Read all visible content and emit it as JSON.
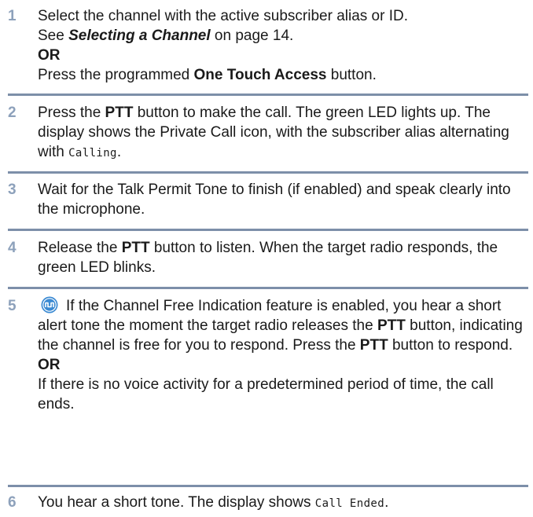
{
  "steps": [
    {
      "num": "1",
      "line1": "Select the channel with the active subscriber alias or ID.",
      "line2_pre": "See ",
      "line2_ref": "Selecting a Channel",
      "line2_post": " on page 14.",
      "or_label": "OR",
      "line4_pre": "Press the programmed ",
      "line4_bold": "One Touch Access",
      "line4_post": " button."
    },
    {
      "num": "2",
      "pre": "Press the ",
      "bold": "PTT",
      "post": " button to make the call. The green LED lights up. The display shows the Private Call icon, with the subscriber alias alternating with ",
      "display_text": "Calling",
      "end": "."
    },
    {
      "num": "3",
      "text": "Wait for the Talk Permit Tone to finish (if enabled) and speak clearly into the microphone."
    },
    {
      "num": "4",
      "pre": "Release the ",
      "bold": "PTT",
      "post": " button to listen. When the target radio responds, the green LED blinks."
    },
    {
      "num": "5",
      "icon": "tone-icon",
      "p1": "If the Channel Free Indication feature is enabled, you hear a short alert tone the moment the target radio releases the ",
      "b1": "PTT",
      "p2": " button, indicating the channel is free for you to respond. Press the ",
      "b2": "PTT",
      "p3": " button to respond.",
      "or_label": "OR",
      "alt": "If there is no voice activity for a predetermined period of time, the call ends."
    },
    {
      "num": "6",
      "pre": "You hear a short tone. The display shows ",
      "display_text": "Call Ended",
      "end": "."
    }
  ],
  "colors": {
    "step_number": "#8da1bb",
    "rule": "#7d8fa9",
    "icon_fill": "#3b8ad3"
  }
}
